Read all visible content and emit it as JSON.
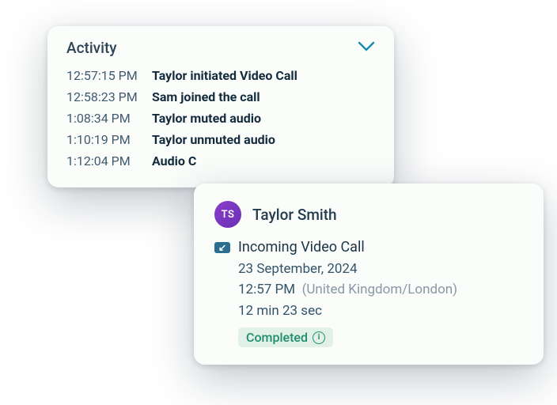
{
  "activity": {
    "title": "Activity",
    "rows": [
      {
        "time": "12:57:15 PM",
        "event": "Taylor initiated Video Call"
      },
      {
        "time": "12:58:23 PM",
        "event": "Sam joined the call"
      },
      {
        "time": "1:08:34 PM",
        "event": "Taylor muted audio"
      },
      {
        "time": "1:10:19 PM",
        "event": "Taylor unmuted audio"
      },
      {
        "time": "1:12:04 PM",
        "event": "Audio C"
      }
    ]
  },
  "call": {
    "avatar_initials": "TS",
    "name": "Taylor Smith",
    "incoming_label": "Incoming Video Call",
    "date": "23 September, 2024",
    "time": "12:57 PM",
    "timezone": "(United Kingdom/London)",
    "duration": "12 min 23 sec",
    "status": "Completed"
  }
}
